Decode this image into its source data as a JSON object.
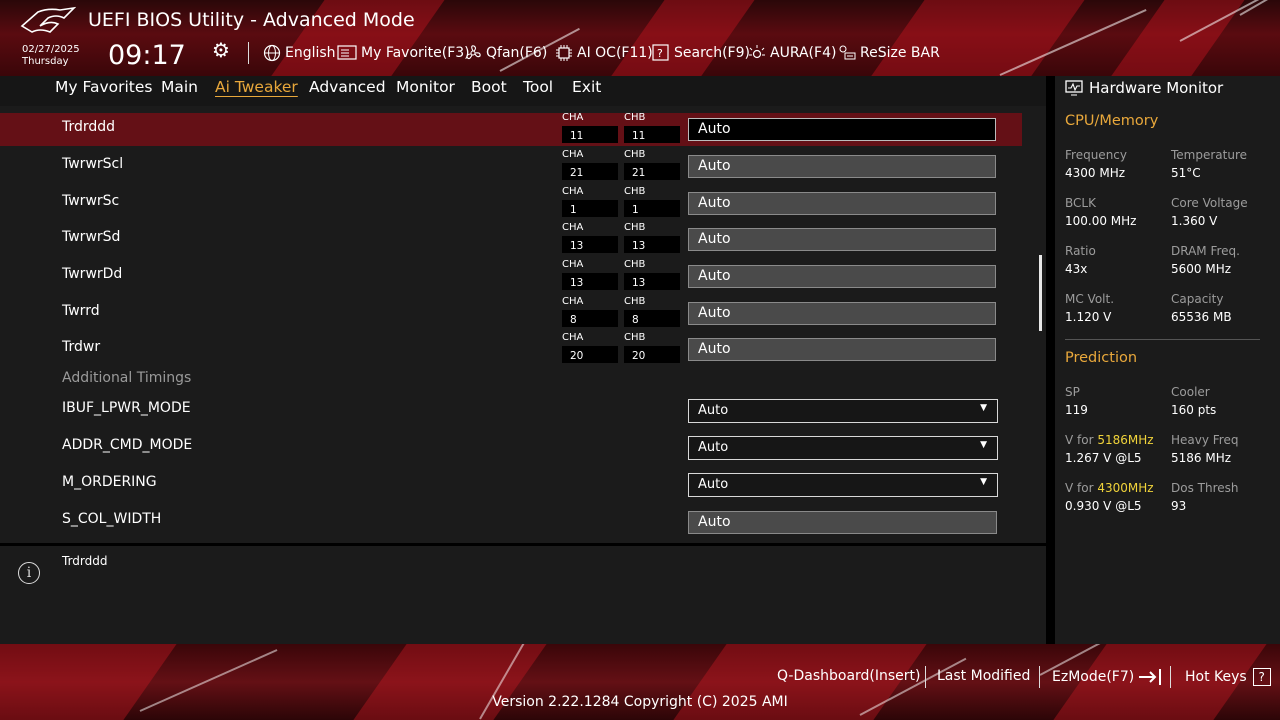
{
  "header": {
    "title": "UEFI BIOS Utility - Advanced Mode",
    "date": "02/27/2025",
    "day": "Thursday",
    "time": "09:17",
    "toolbar": [
      {
        "name": "language",
        "icon": "globe-icon",
        "label": "English"
      },
      {
        "name": "my-favorite",
        "icon": "favorite-icon",
        "label": "My Favorite(F3)"
      },
      {
        "name": "qfan",
        "icon": "fan-icon",
        "label": "Qfan(F6)"
      },
      {
        "name": "ai-oc",
        "icon": "chip-icon",
        "label": "AI OC(F11)"
      },
      {
        "name": "search",
        "icon": "search-icon",
        "label": "Search(F9)"
      },
      {
        "name": "aura",
        "icon": "aura-icon",
        "label": "AURA(F4)"
      },
      {
        "name": "resize-bar",
        "icon": "resize-bar-icon",
        "label": "ReSize BAR"
      }
    ]
  },
  "nav": {
    "tabs": [
      "My Favorites",
      "Main",
      "Ai Tweaker",
      "Advanced",
      "Monitor",
      "Boot",
      "Tool",
      "Exit"
    ],
    "active": "Ai Tweaker"
  },
  "settings": {
    "timing_rows": [
      {
        "label": "Trdrddd",
        "cha": "11",
        "chb": "11",
        "value": "Auto",
        "selected": true
      },
      {
        "label": "TwrwrScl",
        "cha": "21",
        "chb": "21",
        "value": "Auto"
      },
      {
        "label": "TwrwrSc",
        "cha": "1",
        "chb": "1",
        "value": "Auto"
      },
      {
        "label": "TwrwrSd",
        "cha": "13",
        "chb": "13",
        "value": "Auto"
      },
      {
        "label": "TwrwrDd",
        "cha": "13",
        "chb": "13",
        "value": "Auto"
      },
      {
        "label": "Twrrd",
        "cha": "8",
        "chb": "8",
        "value": "Auto"
      },
      {
        "label": "Trdwr",
        "cha": "20",
        "chb": "20",
        "value": "Auto"
      }
    ],
    "channel_labels": {
      "a": "CHA",
      "b": "CHB"
    },
    "section_heading": "Additional Timings",
    "option_rows": [
      {
        "label": "IBUF_LPWR_MODE",
        "value": "Auto",
        "type": "dropdown"
      },
      {
        "label": "ADDR_CMD_MODE",
        "value": "Auto",
        "type": "dropdown"
      },
      {
        "label": "M_ORDERING",
        "value": "Auto",
        "type": "dropdown"
      },
      {
        "label": "S_COL_WIDTH",
        "value": "Auto",
        "type": "field"
      }
    ]
  },
  "info": {
    "text": "Trdrddd"
  },
  "hardware_monitor": {
    "title": "Hardware Monitor",
    "cpu_memory": {
      "title": "CPU/Memory",
      "items": [
        {
          "label": "Frequency",
          "value": "4300 MHz"
        },
        {
          "label": "Temperature",
          "value": "51°C"
        },
        {
          "label": "BCLK",
          "value": "100.00 MHz"
        },
        {
          "label": "Core Voltage",
          "value": "1.360 V"
        },
        {
          "label": "Ratio",
          "value": "43x"
        },
        {
          "label": "DRAM Freq.",
          "value": "5600 MHz"
        },
        {
          "label": "MC Volt.",
          "value": "1.120 V"
        },
        {
          "label": "Capacity",
          "value": "65536 MB"
        }
      ]
    },
    "prediction": {
      "title": "Prediction",
      "sp_label": "SP",
      "sp_value": "119",
      "cooler_label": "Cooler",
      "cooler_value": "160 pts",
      "v_for_prefix": "V for",
      "v1_freq": "5186MHz",
      "v1_value": "1.267 V @L5",
      "heavy_label": "Heavy Freq",
      "heavy_value": "5186 MHz",
      "v2_freq": "4300MHz",
      "v2_value": "0.930 V @L5",
      "dos_label": "Dos Thresh",
      "dos_value": "93"
    }
  },
  "footer": {
    "q_dashboard": "Q-Dashboard(Insert)",
    "last_modified": "Last Modified",
    "ezmode": "EzMode(F7)",
    "hot_keys": "Hot Keys",
    "version": "Version 2.22.1284 Copyright (C) 2025 AMI"
  },
  "colors": {
    "accent": "#e9a83b",
    "selected_row": "#641016",
    "highlight": "#f0d33a"
  }
}
